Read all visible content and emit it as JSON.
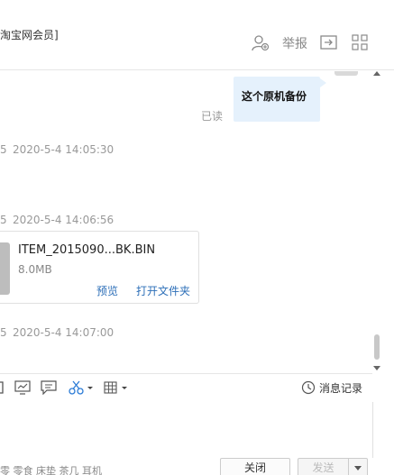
{
  "header": {
    "member_text": "淘宝网会员]",
    "report_label": "举报"
  },
  "chat": {
    "my_message": "这个原机备份",
    "read_status": "已读",
    "timestamps": [
      {
        "prefix": "5",
        "time": "2020-5-4 14:05:30"
      },
      {
        "prefix": "5",
        "time": "2020-5-4 14:06:56"
      },
      {
        "prefix": "5",
        "time": "2020-5-4 14:07:00"
      }
    ],
    "file": {
      "name": "ITEM_2015090...BK.BIN",
      "size": "8.0MB",
      "preview_label": "预览",
      "open_folder_label": "打开文件夹"
    }
  },
  "toolbar": {
    "history_label": "消息记录"
  },
  "bottom": {
    "tags": "零  零食  床垫  茶几  耳机",
    "close_label": "关闭",
    "send_label": "发送"
  },
  "colors": {
    "bubble": "#e5f1fc",
    "link": "#2d6fb8",
    "accent_icon": "#2b7bd6"
  }
}
